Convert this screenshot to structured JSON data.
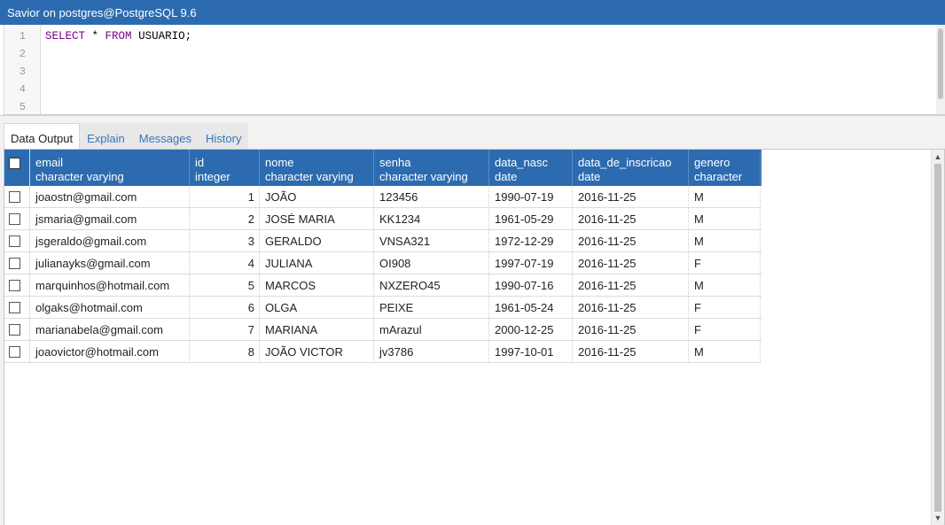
{
  "window": {
    "title": "Savior on postgres@PostgreSQL 9.6"
  },
  "editor": {
    "line_numbers": [
      "1",
      "2",
      "3",
      "4",
      "5"
    ],
    "query": {
      "kw1": "SELECT",
      "star": " *",
      "kw2": "FROM",
      "table": " USUARIO;"
    }
  },
  "tabs": [
    {
      "label": "Data Output"
    },
    {
      "label": "Explain"
    },
    {
      "label": "Messages"
    },
    {
      "label": "History"
    }
  ],
  "grid": {
    "columns": [
      {
        "name": "email",
        "type": "character varying"
      },
      {
        "name": "id",
        "type": "integer"
      },
      {
        "name": "nome",
        "type": "character varying"
      },
      {
        "name": "senha",
        "type": "character varying"
      },
      {
        "name": "data_nasc",
        "type": "date"
      },
      {
        "name": "data_de_inscricao",
        "type": "date"
      },
      {
        "name": "genero",
        "type": "character"
      }
    ],
    "rows": [
      [
        "joaostn@gmail.com",
        "1",
        "JOÃO",
        "123456",
        "1990-07-19",
        "2016-11-25",
        "M"
      ],
      [
        "jsmaria@gmail.com",
        "2",
        "JOSÉ MARIA",
        "KK1234",
        "1961-05-29",
        "2016-11-25",
        "M"
      ],
      [
        "jsgeraldo@gmail.com",
        "3",
        "GERALDO",
        "VNSA321",
        "1972-12-29",
        "2016-11-25",
        "M"
      ],
      [
        "julianayks@gmail.com",
        "4",
        "JULIANA",
        "OI908",
        "1997-07-19",
        "2016-11-25",
        "F"
      ],
      [
        "marquinhos@hotmail.com",
        "5",
        "MARCOS",
        "NXZERO45",
        "1990-07-16",
        "2016-11-25",
        "M"
      ],
      [
        "olgaks@hotmail.com",
        "6",
        "OLGA",
        "PEIXE",
        "1961-05-24",
        "2016-11-25",
        "F"
      ],
      [
        "marianabela@gmail.com",
        "7",
        "MARIANA",
        "mArazul",
        "2000-12-25",
        "2016-11-25",
        "F"
      ],
      [
        "joaovictor@hotmail.com",
        "8",
        "JOÃO VICTOR",
        "jv3786",
        "1997-10-01",
        "2016-11-25",
        "M"
      ]
    ]
  },
  "icons": {
    "scroll_up": "scroll-up-arrow-icon",
    "scroll_down": "scroll-down-arrow-icon"
  },
  "colors": {
    "header_blue": "#2c6bb0",
    "keyword_purple": "#770088",
    "tab_link": "#3376bd"
  }
}
